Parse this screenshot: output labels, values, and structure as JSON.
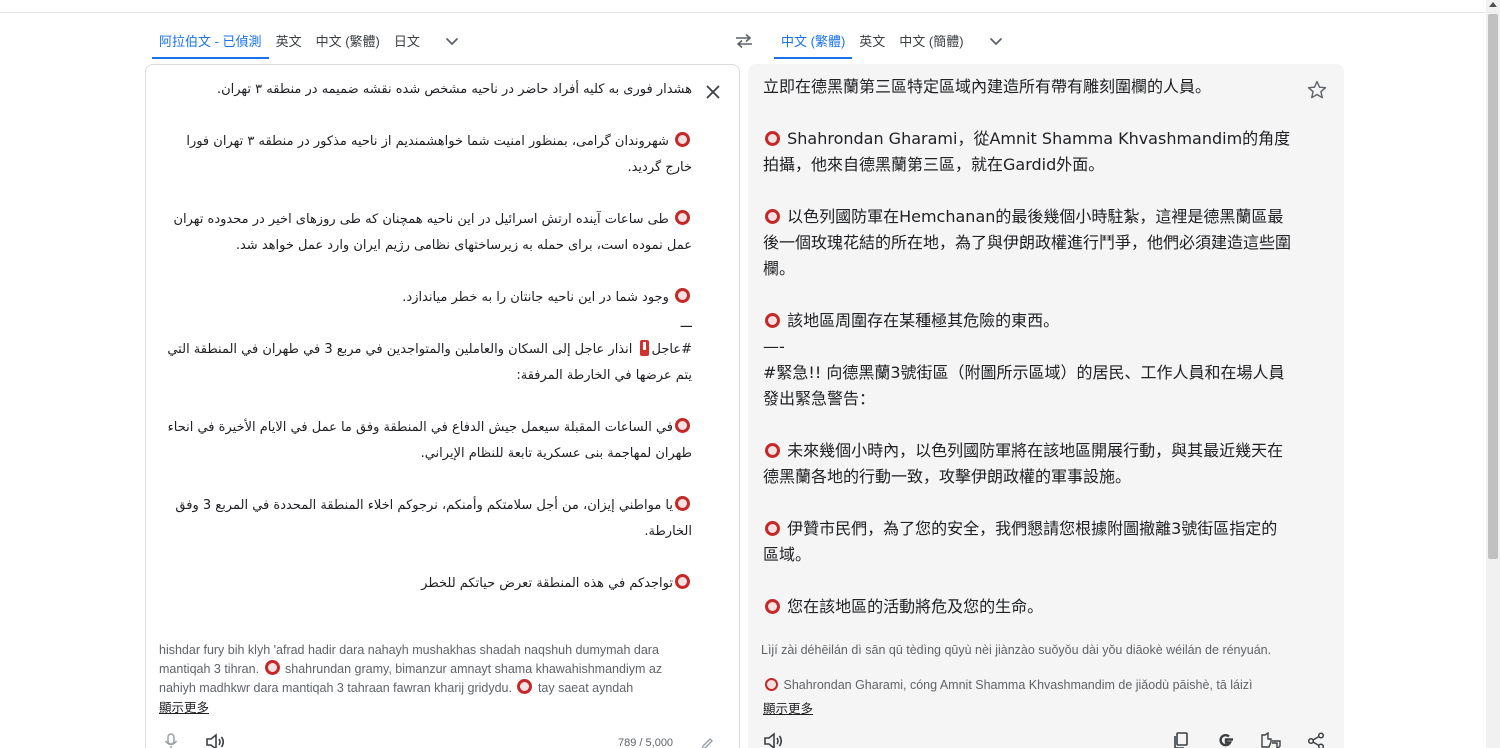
{
  "source": {
    "languages": [
      {
        "label": "阿拉伯文 - 已偵測",
        "active": true
      },
      {
        "label": "英文",
        "active": false
      },
      {
        "label": "中文 (繁體)",
        "active": false
      },
      {
        "label": "日文",
        "active": false
      }
    ],
    "paragraphs": {
      "p1": "هشدار فوری به کلیه أفراد حاضر  در ناحیه مشخص شده نقشه ضمیمه در منطقه ۳ تهران.",
      "p2": "شهروندان گرامی، بمنظور امنیت  شما خواهشمندیم از ناحیه مذکور در منطقه ۳ تهران فورا خارج گردید.",
      "p3": "طی ساعات آینده ارتش اسرائیل در این ناحیه همچنان که طی روزهای اخیر در محدوده تهران عمل نموده است، برای حمله به زیرساختهای نظامی رژیم ایران وارد عمل خواهد شد.",
      "p4": "وجود شما در این ناحیه جانتان را به خطر میاندازد.",
      "p5": "ـــ",
      "p6_a": "#عاجل",
      "p6_b": "انذار عاجل إلى السكان والعاملين والمتواجدين في مربع 3 في طهران في المنطقة التي يتم عرضها في الخارطة المرفقة:",
      "p7": "في الساعات المقبلة سيعمل جيش الدفاع في المنطقة وفق ما عمل في الايام الأخيرة في انحاء طهران لمهاجمة بنى عسكرية تابعة للنظام الإيراني.",
      "p8": "يا مواطني إيزان، من أجل سلامتكم وأمنكم، نرجوكم اخلاء المنطقة المحددة في المربع 3 وفق الخارطة.",
      "p9": "تواجدكم في هذه المنطقة تعرض حياتكم للخطر"
    },
    "romanization_a": "hishdar fury bih klyh 'afrad hadir dara nahayh mushakhas shadah naqshuh dumymah dara mantiqah 3 tihran.",
    "romanization_b": "shahrundan gramy, bimanzur amnayt shama khawahishmandiym az nahiyh madhkwr dara mantiqah 3 tahraan fawran kharij gridydu.",
    "romanization_c": "tay saeat ayndah",
    "show_more": "顯示更多",
    "char_count": "789 / 5,000"
  },
  "target": {
    "languages": [
      {
        "label": "中文 (繁體)",
        "active": true
      },
      {
        "label": "英文",
        "active": false
      },
      {
        "label": "中文 (簡體)",
        "active": false
      }
    ],
    "paragraphs": {
      "p1": "立即在德黑蘭第三區特定區域內建造所有帶有雕刻圍欄的人員。",
      "p2": "Shahrondan Gharami，從Amnit Shamma Khvashmandim的角度拍攝，他來自德黑蘭第三區，就在Gardid外面。",
      "p3": "以色列國防軍在Hemchanan的最後幾個小時駐紮，這裡是德黑蘭區最後一個玫瑰花結的所在地，為了與伊朗政權進行鬥爭，他們必須建造這些圍欄。",
      "p4": "該地區周圍存在某種極其危險的東西。",
      "p5": "—-",
      "p6": "#緊急!! 向德黑蘭3號街區（附圖所示區域）的居民、工作人員和在場人員發出緊急警告：",
      "p7": "未來幾個小時內，以色列國防軍將在該地區開展行動，與其最近幾天在德黑蘭各地的行動一致，攻擊伊朗政權的軍事設施。",
      "p8": "伊贊市民們，為了您的安全，我們懇請您根據附圖撤離3號街區指定的區域。",
      "p9": "您在該地區的活動將危及您的生命。"
    },
    "romanization": "Lìjí zài déhēilán dì sān qū tèdìng qūyù nèi jiànzào suǒyǒu dài yǒu diāokè wéilán de rényuán.",
    "romanization_2": "Shahrondan Gharami, cóng Amnit Shamma Khvashmandim de jiǎodù pāishè, tā láizì",
    "show_more": "顯示更多"
  },
  "icons": {
    "swap": "swap-arrows-icon",
    "close": "close-icon",
    "star": "star-icon",
    "mic": "microphone-icon",
    "speaker": "speaker-icon",
    "copy": "copy-icon",
    "google": "google-icon",
    "feedback": "thumbs-feedback-icon",
    "share": "share-icon",
    "edit": "pencil-icon"
  },
  "colors": {
    "accent": "#1a73e8",
    "marker": "#c62828",
    "target_bg": "#f5f5f5"
  }
}
